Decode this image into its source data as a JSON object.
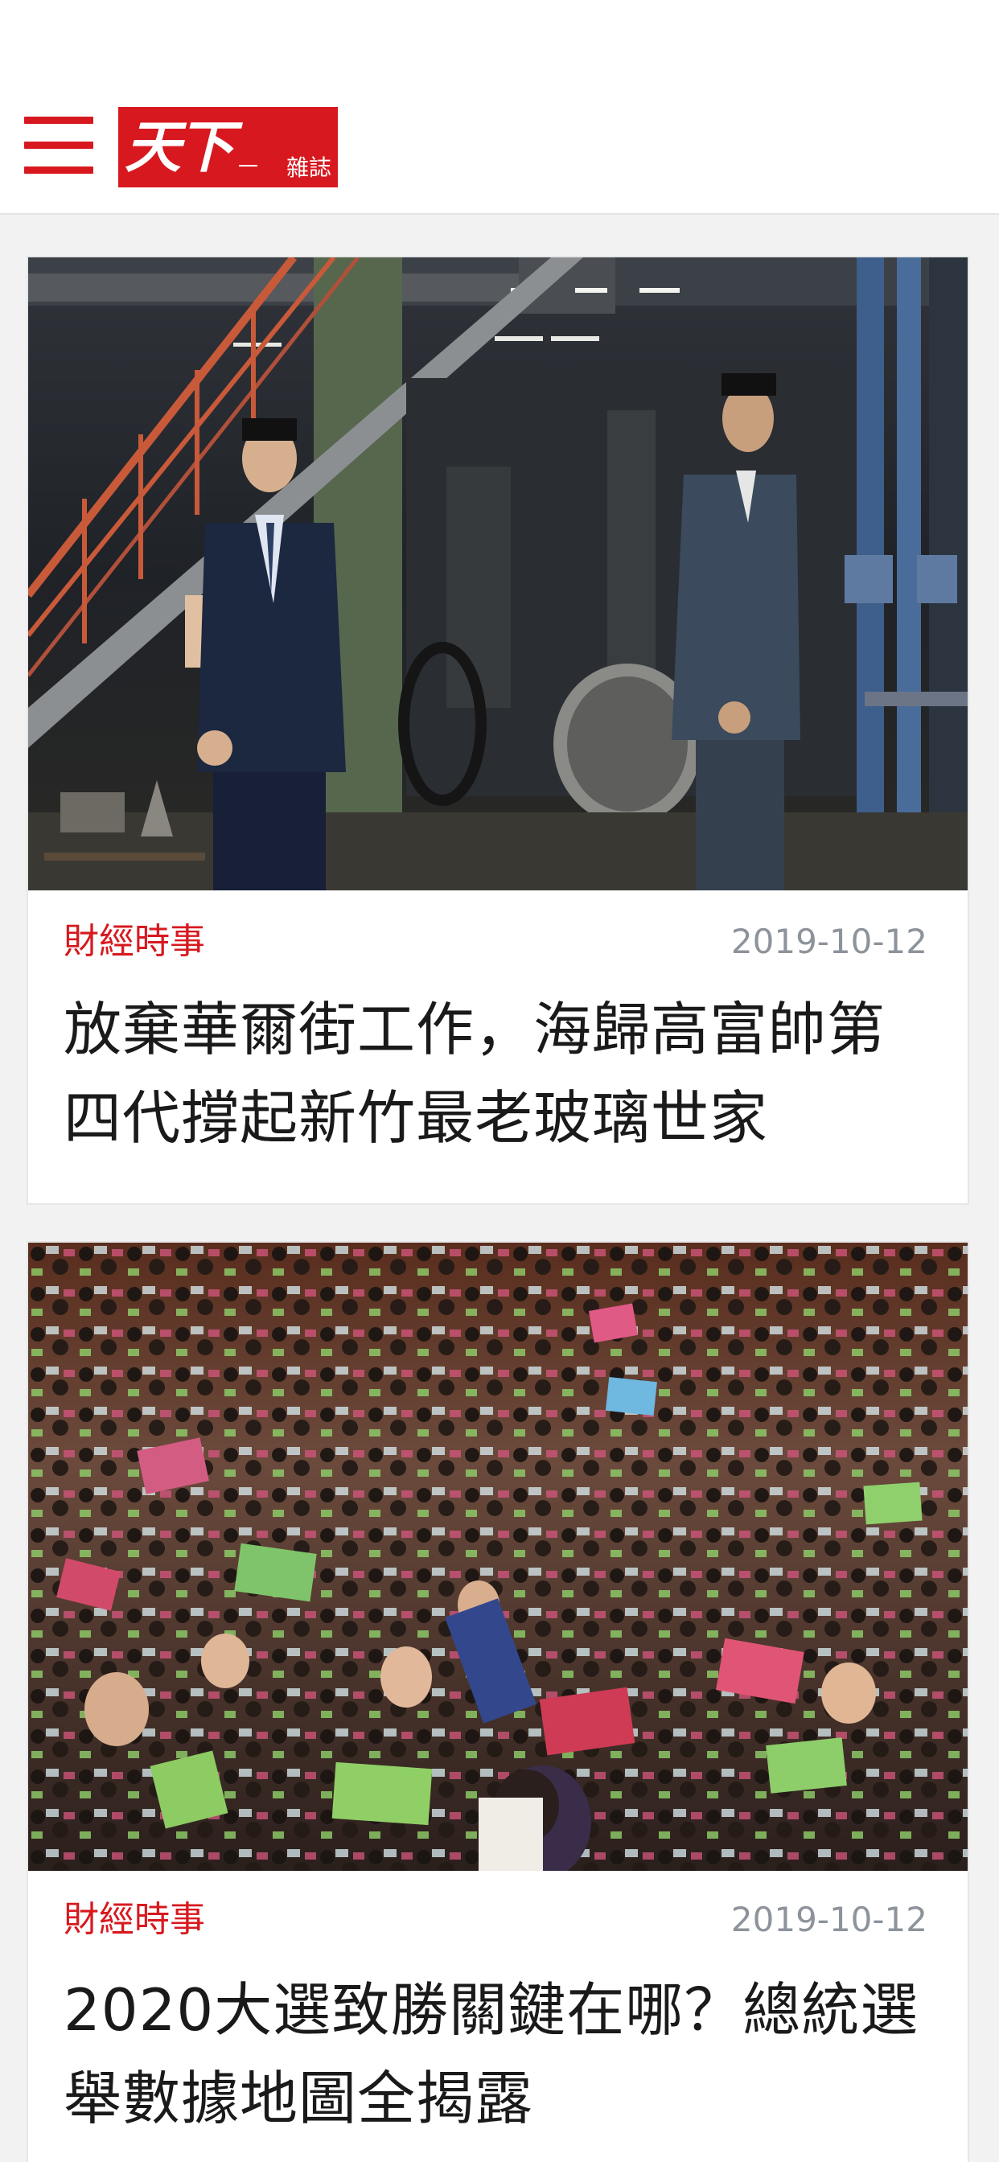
{
  "header": {
    "logo_main": "天下",
    "logo_sub": "雜誌"
  },
  "articles": [
    {
      "category": "財經時事",
      "date": "2019-10-12",
      "title": "放棄華爾街工作，海歸高富帥第四代撐起新竹最老玻璃世家"
    },
    {
      "category": "財經時事",
      "date": "2019-10-12",
      "title": "2020大選致勝關鍵在哪？總統選舉數據地圖全揭露"
    }
  ],
  "colors": {
    "brand_red": "#d7191f",
    "date_gray": "#8d939b",
    "title_black": "#1a1a1a"
  }
}
